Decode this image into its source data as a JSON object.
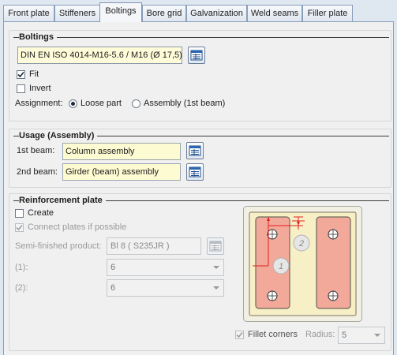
{
  "tabs": [
    {
      "label": "Front plate"
    },
    {
      "label": "Stiffeners"
    },
    {
      "label": "Boltings"
    },
    {
      "label": "Bore grid"
    },
    {
      "label": "Galvanization"
    },
    {
      "label": "Weld seams"
    },
    {
      "label": "Filler plate"
    }
  ],
  "active_tab": "Boltings",
  "boltings": {
    "title": "Boltings",
    "bolt_value": "DIN EN ISO 4014-M16-5.6 / M16 (Ø 17,5)",
    "fit_label": "Fit",
    "fit_checked": true,
    "invert_label": "Invert",
    "invert_checked": false,
    "assignment_label": "Assignment:",
    "loose_part_label": "Loose part",
    "assembly_label": "Assembly (1st beam)",
    "assignment_selected": "Loose part"
  },
  "usage": {
    "title": "Usage (Assembly)",
    "beam1_label": "1st beam:",
    "beam1_value": "Column assembly",
    "beam2_label": "2nd beam:",
    "beam2_value": "Girder (beam) assembly"
  },
  "reinforcement": {
    "title": "Reinforcement plate",
    "create_label": "Create",
    "create_checked": false,
    "connect_label": "Connect plates if possible",
    "connect_checked": true,
    "semi_label": "Semi-finished product:",
    "semi_value": "Bl 8  ( S235JR )",
    "field1_label": "(1):",
    "field1_value": "6",
    "field2_label": "(2):",
    "field2_value": "6",
    "preview_num1": "1",
    "preview_num2": "2",
    "fillet_label": "Fillet corners",
    "fillet_checked": true,
    "radius_label": "Radius:",
    "radius_value": "5"
  },
  "colors": {
    "plate_fill": "#f2a99a",
    "plate_border": "#6e6a5a",
    "dimension_red": "#e02020",
    "panel_bg": "#f0f0f0",
    "tab_border": "#8a9fb8"
  },
  "icons": {
    "catalog_button": "catalog-table-icon",
    "checkmark": "check-mark-icon",
    "dropdown": "chevron-down-icon"
  }
}
